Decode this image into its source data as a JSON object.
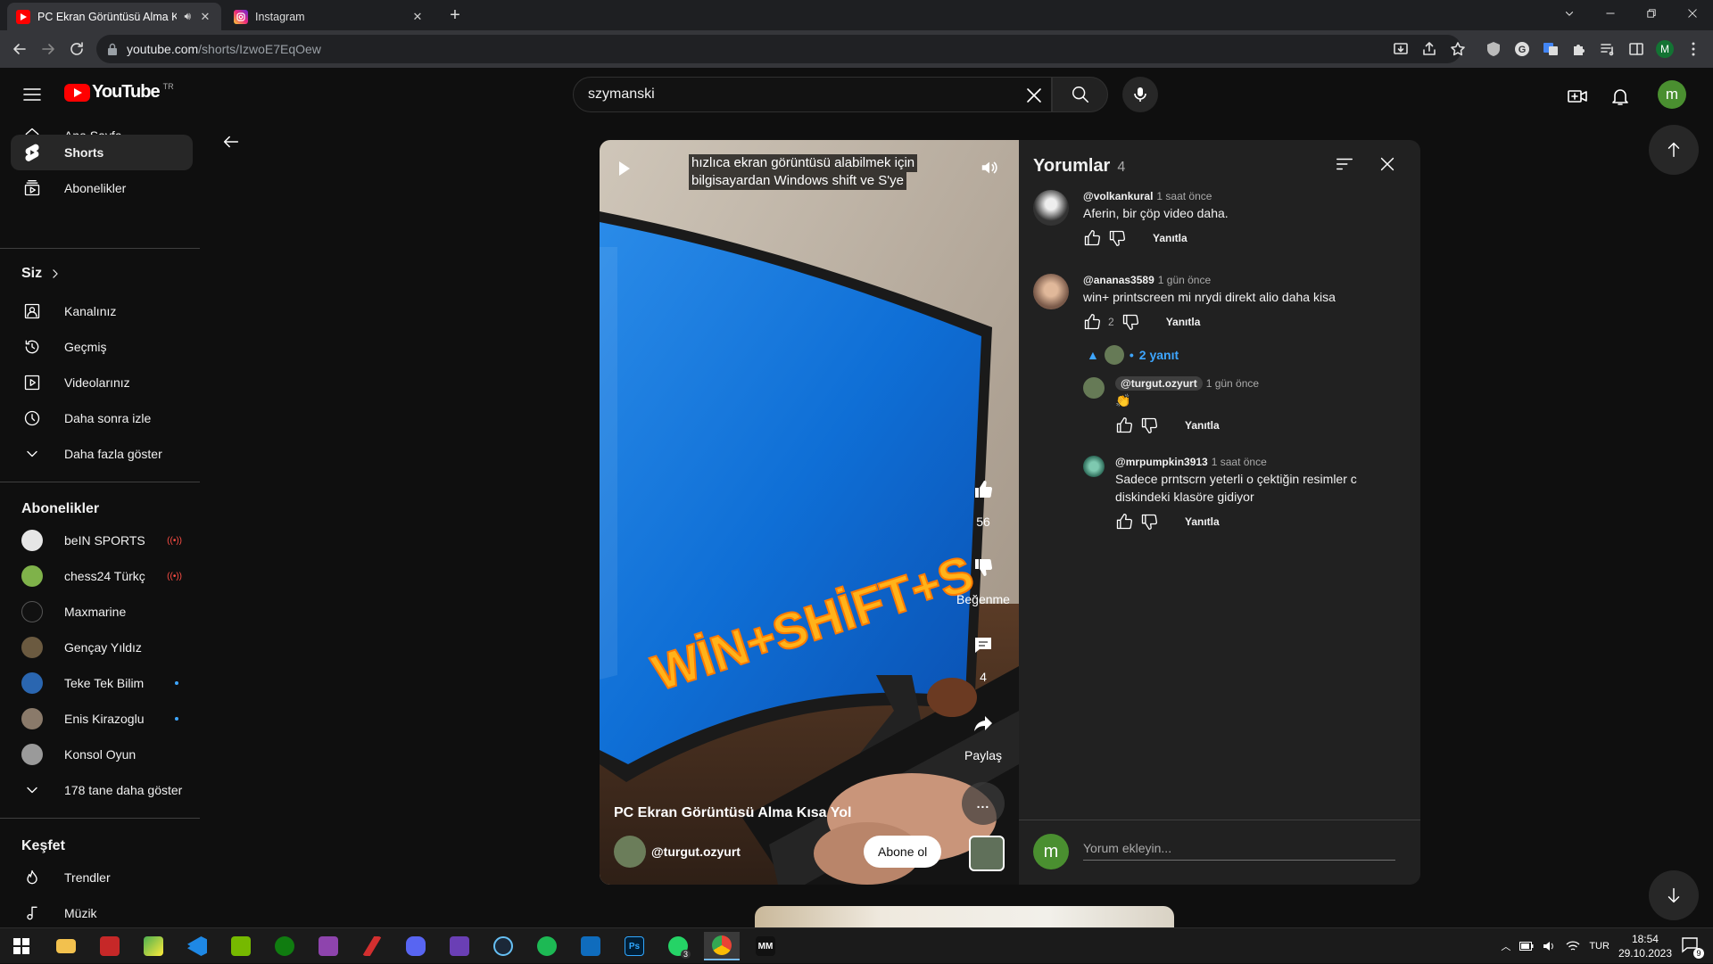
{
  "browser": {
    "tabs": [
      {
        "title": "PC Ekran Görüntüsü Alma K",
        "active": true
      },
      {
        "title": "Instagram",
        "active": false
      }
    ],
    "url_host": "youtube.com",
    "url_path": "/shorts/IzwoE7EqOew"
  },
  "masthead": {
    "logo_text": "YouTube",
    "region": "TR",
    "search_value": "szymanski",
    "avatar_letter": "m"
  },
  "sidebar": {
    "main": [
      {
        "label": "Ana Sayfa",
        "icon": "home-icon"
      },
      {
        "label": "Shorts",
        "icon": "shorts-icon",
        "active": true
      },
      {
        "label": "Abonelikler",
        "icon": "subscriptions-icon"
      }
    ],
    "you_heading": "Siz",
    "you": [
      {
        "label": "Kanalınız",
        "icon": "channel-icon"
      },
      {
        "label": "Geçmiş",
        "icon": "history-icon"
      },
      {
        "label": "Videolarınız",
        "icon": "your-videos-icon"
      },
      {
        "label": "Daha sonra izle",
        "icon": "watch-later-icon"
      },
      {
        "label": "Daha fazla göster",
        "icon": "chevron-down-icon"
      }
    ],
    "subs_heading": "Abonelikler",
    "subs": [
      {
        "label": "beIN SPORTS Tü...",
        "badge": "live",
        "color": "#e6e6e6"
      },
      {
        "label": "chess24 Türkçe",
        "badge": "live",
        "color": "#7fb24a"
      },
      {
        "label": "Maxmarine",
        "badge": "",
        "color": "#111111"
      },
      {
        "label": "Gençay Yıldız",
        "badge": "",
        "color": "#6b5a40"
      },
      {
        "label": "Teke Tek Bilim",
        "badge": "dot",
        "color": "#2a66b0"
      },
      {
        "label": "Enis Kirazoglu",
        "badge": "dot",
        "color": "#8a7a6a"
      },
      {
        "label": "Konsol Oyun",
        "badge": "",
        "color": "#9a9a9a"
      }
    ],
    "subs_more": "178 tane daha göster",
    "explore_heading": "Keşfet",
    "explore": [
      {
        "label": "Trendler",
        "icon": "trending-icon"
      },
      {
        "label": "Müzik",
        "icon": "music-icon"
      }
    ]
  },
  "short": {
    "caption_line1": "hızlıca ekran görüntüsü alabilmek için",
    "caption_line2": "bilgisayardan Windows shift ve S'ye",
    "overlay_text": "WİN+SHİFT+S",
    "like_count": "56",
    "dislike_label": "Beğenme",
    "comment_count": "4",
    "share_label": "Paylaş",
    "more_label": "...",
    "title": "PC Ekran Görüntüsü Alma Kısa Yol",
    "channel": "@turgut.ozyurt",
    "subscribe_label": "Abone ol"
  },
  "comments": {
    "heading": "Yorumlar",
    "count": "4",
    "reply_label": "Yanıtla",
    "replies_toggle": "2 yanıt",
    "items": [
      {
        "author": "@volkankural",
        "time": "1 saat önce",
        "text": "Aferin, bir çöp video daha.",
        "likes": ""
      },
      {
        "author": "@ananas3589",
        "time": "1 gün önce",
        "text": "win+ printscreen mi nrydi direkt alio daha kisa",
        "likes": "2"
      }
    ],
    "replies": [
      {
        "author": "@turgut.ozyurt",
        "time": "1 gün önce",
        "text": "👏"
      },
      {
        "author": "@mrpumpkin3913",
        "time": "1 saat önce",
        "text": "Sadece prntscrn yeterli o çektiğin resimler c diskindeki klasöre gidiyor"
      }
    ],
    "input_placeholder": "Yorum ekleyin...",
    "input_avatar_letter": "m"
  },
  "taskbar": {
    "apps": [
      "file-explorer",
      "app-red",
      "app-sniptool",
      "vscode",
      "nvidia",
      "xbox",
      "visual-studio",
      "app-slash",
      "discord",
      "visual-studio-2",
      "steam",
      "spotify",
      "outlook",
      "photoshop",
      "whatsapp",
      "chrome",
      "mm-app"
    ],
    "whatsapp_badge": "3",
    "language": "TUR",
    "time": "18:54",
    "date": "29.10.2023",
    "notifications": "9"
  }
}
